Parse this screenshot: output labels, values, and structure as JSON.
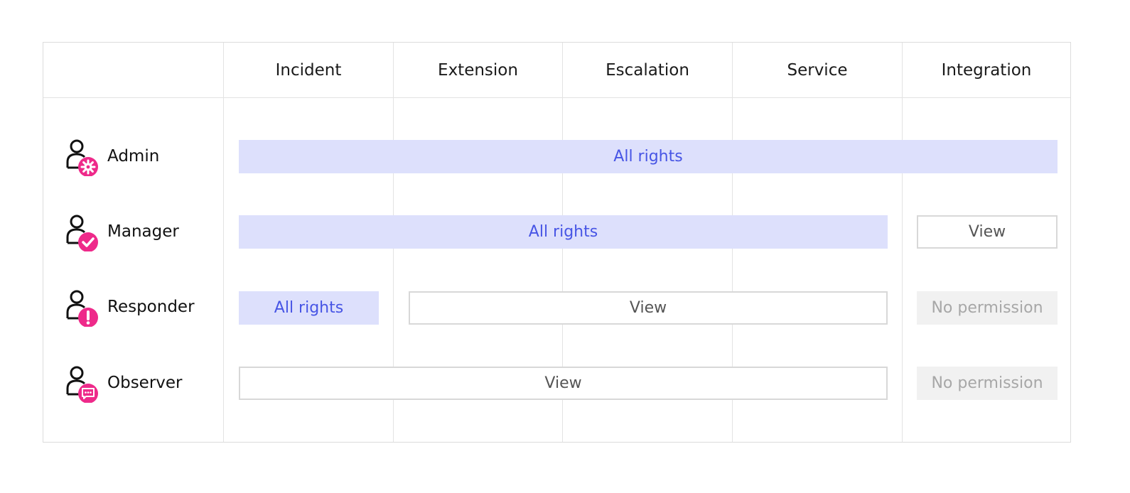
{
  "columns": [
    "Incident",
    "Extension",
    "Escalation",
    "Service",
    "Integration"
  ],
  "roles": [
    {
      "label": "Admin",
      "badge_icon": "gear-icon"
    },
    {
      "label": "Manager",
      "badge_icon": "check-icon"
    },
    {
      "label": "Responder",
      "badge_icon": "exclamation-icon"
    },
    {
      "label": "Observer",
      "badge_icon": "chat-bubble-icon"
    }
  ],
  "permissions": {
    "admin": [
      {
        "label": "All rights",
        "level": "all",
        "columns": [
          "Incident",
          "Extension",
          "Escalation",
          "Service",
          "Integration"
        ]
      }
    ],
    "manager": [
      {
        "label": "All rights",
        "level": "all",
        "columns": [
          "Incident",
          "Extension",
          "Escalation",
          "Service"
        ]
      },
      {
        "label": "View",
        "level": "view",
        "columns": [
          "Integration"
        ]
      }
    ],
    "responder": [
      {
        "label": "All rights",
        "level": "all",
        "columns": [
          "Incident"
        ]
      },
      {
        "label": "View",
        "level": "view",
        "columns": [
          "Extension",
          "Escalation",
          "Service"
        ]
      },
      {
        "label": "No permission",
        "level": "none",
        "columns": [
          "Integration"
        ]
      }
    ],
    "observer": [
      {
        "label": "View",
        "level": "view",
        "columns": [
          "Incident",
          "Extension",
          "Escalation",
          "Service"
        ]
      },
      {
        "label": "No permission",
        "level": "none",
        "columns": [
          "Integration"
        ]
      }
    ]
  },
  "colors": {
    "badge": "#ee2a8a",
    "all_rights_fill": "#dde0fc",
    "all_rights_text": "#4755e5",
    "view_border": "#d8d8d8",
    "view_text": "#555555",
    "no_permission_fill": "#f1f1f1",
    "no_permission_text": "#a7a7a7",
    "grid_line": "#e3e3e3"
  }
}
